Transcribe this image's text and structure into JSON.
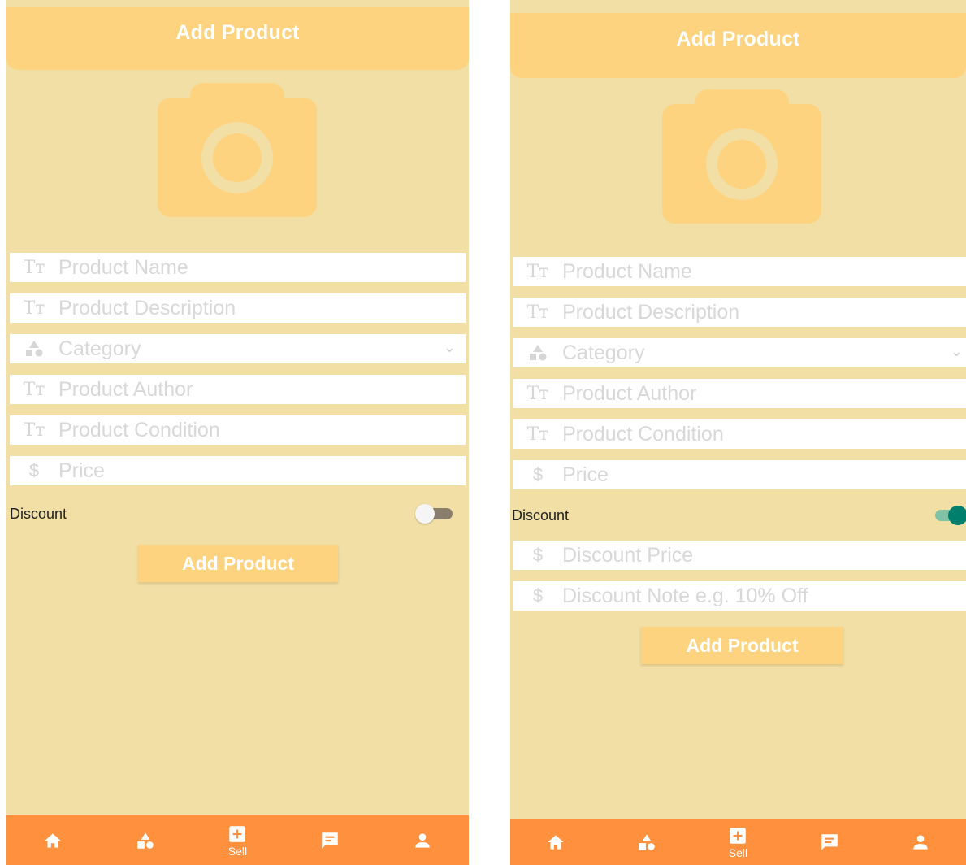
{
  "colors": {
    "background": "#f1dfa6",
    "header": "#fdd37f",
    "nav_bar": "#fe903e",
    "toggle_on": "#00806c"
  },
  "left_screen": {
    "header": {
      "title": "Add Product"
    },
    "photo_placeholder_icon": "camera-icon",
    "fields": [
      {
        "icon": "text-format-icon",
        "placeholder": "Product Name"
      },
      {
        "icon": "text-format-icon",
        "placeholder": "Product Description"
      },
      {
        "icon": "category-icon",
        "placeholder": "Category"
      },
      {
        "icon": "text-format-icon",
        "placeholder": "Product Author"
      },
      {
        "icon": "text-format-icon",
        "placeholder": "Product Condition"
      },
      {
        "icon": "dollar-icon",
        "placeholder": "Price"
      }
    ],
    "discount": {
      "label": "Discount",
      "enabled": false
    },
    "submit_label": "Add Product",
    "nav": [
      {
        "icon": "home-icon",
        "label": ""
      },
      {
        "icon": "category-icon",
        "label": ""
      },
      {
        "icon": "add-box-icon",
        "label": "Sell"
      },
      {
        "icon": "message-icon",
        "label": ""
      },
      {
        "icon": "person-icon",
        "label": ""
      }
    ]
  },
  "right_screen": {
    "header": {
      "title": "Add Product"
    },
    "photo_placeholder_icon": "camera-icon",
    "fields": [
      {
        "icon": "text-format-icon",
        "placeholder": "Product Name"
      },
      {
        "icon": "text-format-icon",
        "placeholder": "Product Description"
      },
      {
        "icon": "category-icon",
        "placeholder": "Category"
      },
      {
        "icon": "text-format-icon",
        "placeholder": "Product Author"
      },
      {
        "icon": "text-format-icon",
        "placeholder": "Product Condition"
      },
      {
        "icon": "dollar-icon",
        "placeholder": "Price"
      }
    ],
    "discount": {
      "label": "Discount",
      "enabled": true
    },
    "discount_fields": [
      {
        "icon": "dollar-icon",
        "placeholder": "Discount Price"
      },
      {
        "icon": "dollar-icon",
        "placeholder": "Discount Note e.g. 10% Off"
      }
    ],
    "submit_label": "Add Product",
    "nav": [
      {
        "icon": "home-icon",
        "label": ""
      },
      {
        "icon": "category-icon",
        "label": ""
      },
      {
        "icon": "add-box-icon",
        "label": "Sell"
      },
      {
        "icon": "message-icon",
        "label": ""
      },
      {
        "icon": "person-icon",
        "label": ""
      }
    ]
  }
}
